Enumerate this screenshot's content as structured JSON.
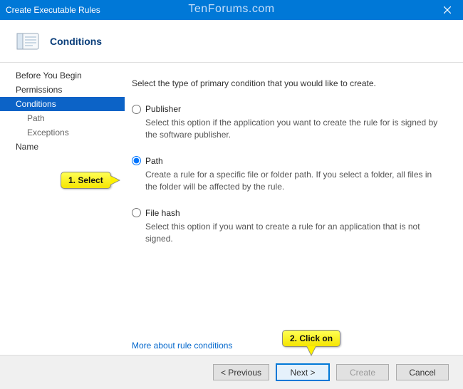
{
  "window": {
    "title": "Create Executable Rules",
    "watermark": "TenForums.com"
  },
  "header": {
    "page_title": "Conditions"
  },
  "sidebar": {
    "items": [
      {
        "label": "Before You Begin",
        "selected": false,
        "indent": 0
      },
      {
        "label": "Permissions",
        "selected": false,
        "indent": 0
      },
      {
        "label": "Conditions",
        "selected": true,
        "indent": 0
      },
      {
        "label": "Path",
        "selected": false,
        "indent": 1
      },
      {
        "label": "Exceptions",
        "selected": false,
        "indent": 1
      },
      {
        "label": "Name",
        "selected": false,
        "indent": 0
      }
    ]
  },
  "content": {
    "intro": "Select the type of primary condition that you would like to create.",
    "options": [
      {
        "key": "publisher",
        "label": "Publisher",
        "desc": "Select this option if the application you want to create the rule for is signed by the software publisher.",
        "checked": false
      },
      {
        "key": "path",
        "label": "Path",
        "desc": "Create a rule for a specific file or folder path. If you select a folder, all files in the folder will be affected by the rule.",
        "checked": true
      },
      {
        "key": "filehash",
        "label": "File hash",
        "desc": "Select this option if you want to create a rule for an application that is not signed.",
        "checked": false
      }
    ],
    "more_link": "More about rule conditions"
  },
  "footer": {
    "previous": "< Previous",
    "next": "Next >",
    "create": "Create",
    "cancel": "Cancel"
  },
  "annotations": {
    "select": "1. Select",
    "click": "2. Click on"
  }
}
